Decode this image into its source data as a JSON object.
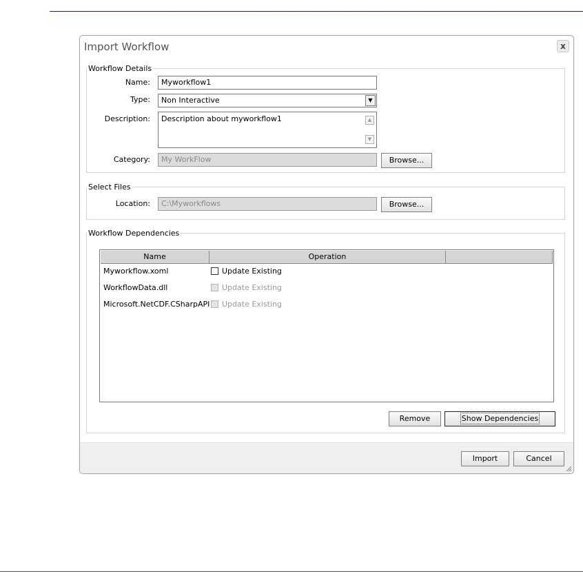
{
  "dialog": {
    "title": "Import Workflow",
    "close_label": "x"
  },
  "workflow_details": {
    "legend": "Workflow Details",
    "name_label": "Name:",
    "name_value": "Myworkflow1",
    "type_label": "Type:",
    "type_value": "Non Interactive",
    "description_label": "Description:",
    "description_value": "Description about myworkflow1",
    "category_label": "Category:",
    "category_value": "My WorkFlow",
    "browse_label": "Browse..."
  },
  "select_files": {
    "legend": "Select Files",
    "location_label": "Location:",
    "location_value": "C:\\Myworkflows",
    "browse_label": "Browse..."
  },
  "dependencies": {
    "legend": "Workflow Dependencies",
    "columns": [
      "Name",
      "Operation",
      ""
    ],
    "rows": [
      {
        "name": "Myworkflow.xoml",
        "operation": "Update Existing",
        "enabled": true,
        "checked": false
      },
      {
        "name": "WorkflowData.dll",
        "operation": "Update Existing",
        "enabled": false,
        "checked": false
      },
      {
        "name": "Microsoft.NetCDF.CSharpAPI",
        "operation": "Update Existing",
        "enabled": false,
        "checked": false
      }
    ],
    "remove_label": "Remove",
    "show_dependencies_label": "Show Dependencies"
  },
  "footer": {
    "import_label": "Import",
    "cancel_label": "Cancel"
  },
  "colors": {
    "top_rule": "#1a1f6a",
    "disabled_field": "#dcdcdc",
    "footer_bg": "#efefef"
  }
}
